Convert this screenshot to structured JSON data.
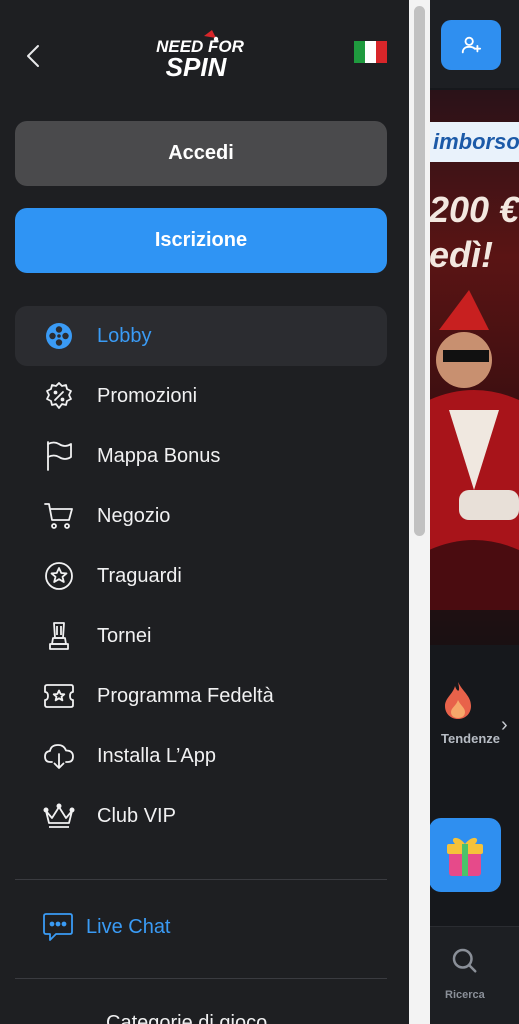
{
  "brand": {
    "logo_line1": "NEED FOR",
    "logo_line2": "SPIN"
  },
  "header": {
    "language_flag": "it-flag-icon",
    "back_icon": "chevron-left-icon"
  },
  "auth": {
    "login_label": "Accedi",
    "signup_label": "Iscrizione"
  },
  "menu": {
    "items": [
      {
        "label": "Lobby",
        "icon": "reel-icon",
        "active": true
      },
      {
        "label": "Promozioni",
        "icon": "percent-badge-icon"
      },
      {
        "label": "Mappa Bonus",
        "icon": "flag-icon"
      },
      {
        "label": "Negozio",
        "icon": "cart-icon"
      },
      {
        "label": "Traguardi",
        "icon": "star-medal-icon"
      },
      {
        "label": "Tornei",
        "icon": "trophy-icon"
      },
      {
        "label": "Programma Fedeltà",
        "icon": "ticket-star-icon"
      },
      {
        "label": "Installa L’App",
        "icon": "cloud-download-icon"
      },
      {
        "label": "Club VIP",
        "icon": "crown-icon"
      }
    ]
  },
  "support": {
    "live_chat_label": "Live Chat",
    "icon": "chat-icon"
  },
  "categories": {
    "heading": "Categorie di gioco"
  },
  "background": {
    "banner_text": "imborso",
    "banner_amount": "200 €",
    "banner_sub": "edì!",
    "trending_label": "Tendenze",
    "search_label": "Ricerca"
  },
  "colors": {
    "accent": "#2f94f4",
    "active_text": "#3a9bf5",
    "sidebar_bg": "#1e1f22",
    "login_bg": "#4a4a4c"
  }
}
